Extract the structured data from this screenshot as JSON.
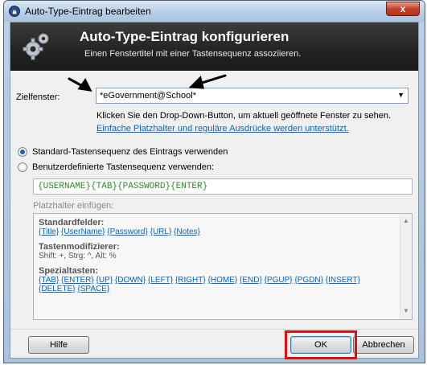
{
  "window": {
    "title": "Auto-Type-Eintrag bearbeiten",
    "close_label": "x"
  },
  "banner": {
    "title": "Auto-Type-Eintrag konfigurieren",
    "subtitle": "Einen Fenstertitel mit einer Tastensequenz assoziieren."
  },
  "target": {
    "label": "Zielfenster:",
    "value": "*eGovernment@School*",
    "hint": "Klicken Sie den Drop-Down-Button, um aktuell geöffnete Fenster zu sehen.",
    "link": "Einfache Platzhalter und reguläre Ausdrücke werden unterstützt."
  },
  "options": {
    "standard_label": "Standard-Tastensequenz des Eintrags verwenden",
    "standard_checked": true,
    "custom_label": "Benutzerdefinierte Tastensequenz verwenden:",
    "custom_checked": false
  },
  "sequence": "{USERNAME}{TAB}{PASSWORD}{ENTER}",
  "placeholders": {
    "label": "Platzhalter einfügen:",
    "standard_heading": "Standardfelder:",
    "standard_fields": [
      "{Title}",
      "{UserName}",
      "{Password}",
      "{URL}",
      "{Notes}"
    ],
    "modifiers_heading": "Tastenmodifizierer:",
    "modifiers_text": "Shift: +, Strg: ^, Alt: %",
    "special_heading": "Spezialtasten:",
    "special_keys": [
      "{TAB}",
      "{ENTER}",
      "{UP}",
      "{DOWN}",
      "{LEFT}",
      "{RIGHT}",
      "{HOME}",
      "{END}",
      "{PGUP}",
      "{PGDN}",
      "{INSERT}",
      "{DELETE}",
      "{SPACE}"
    ]
  },
  "buttons": {
    "help": "Hilfe",
    "ok": "OK",
    "cancel": "Abbrechen"
  },
  "colors": {
    "annotation_highlight": "#e01010",
    "link": "#0066cc",
    "sequence_text": "#2e8b2e"
  }
}
